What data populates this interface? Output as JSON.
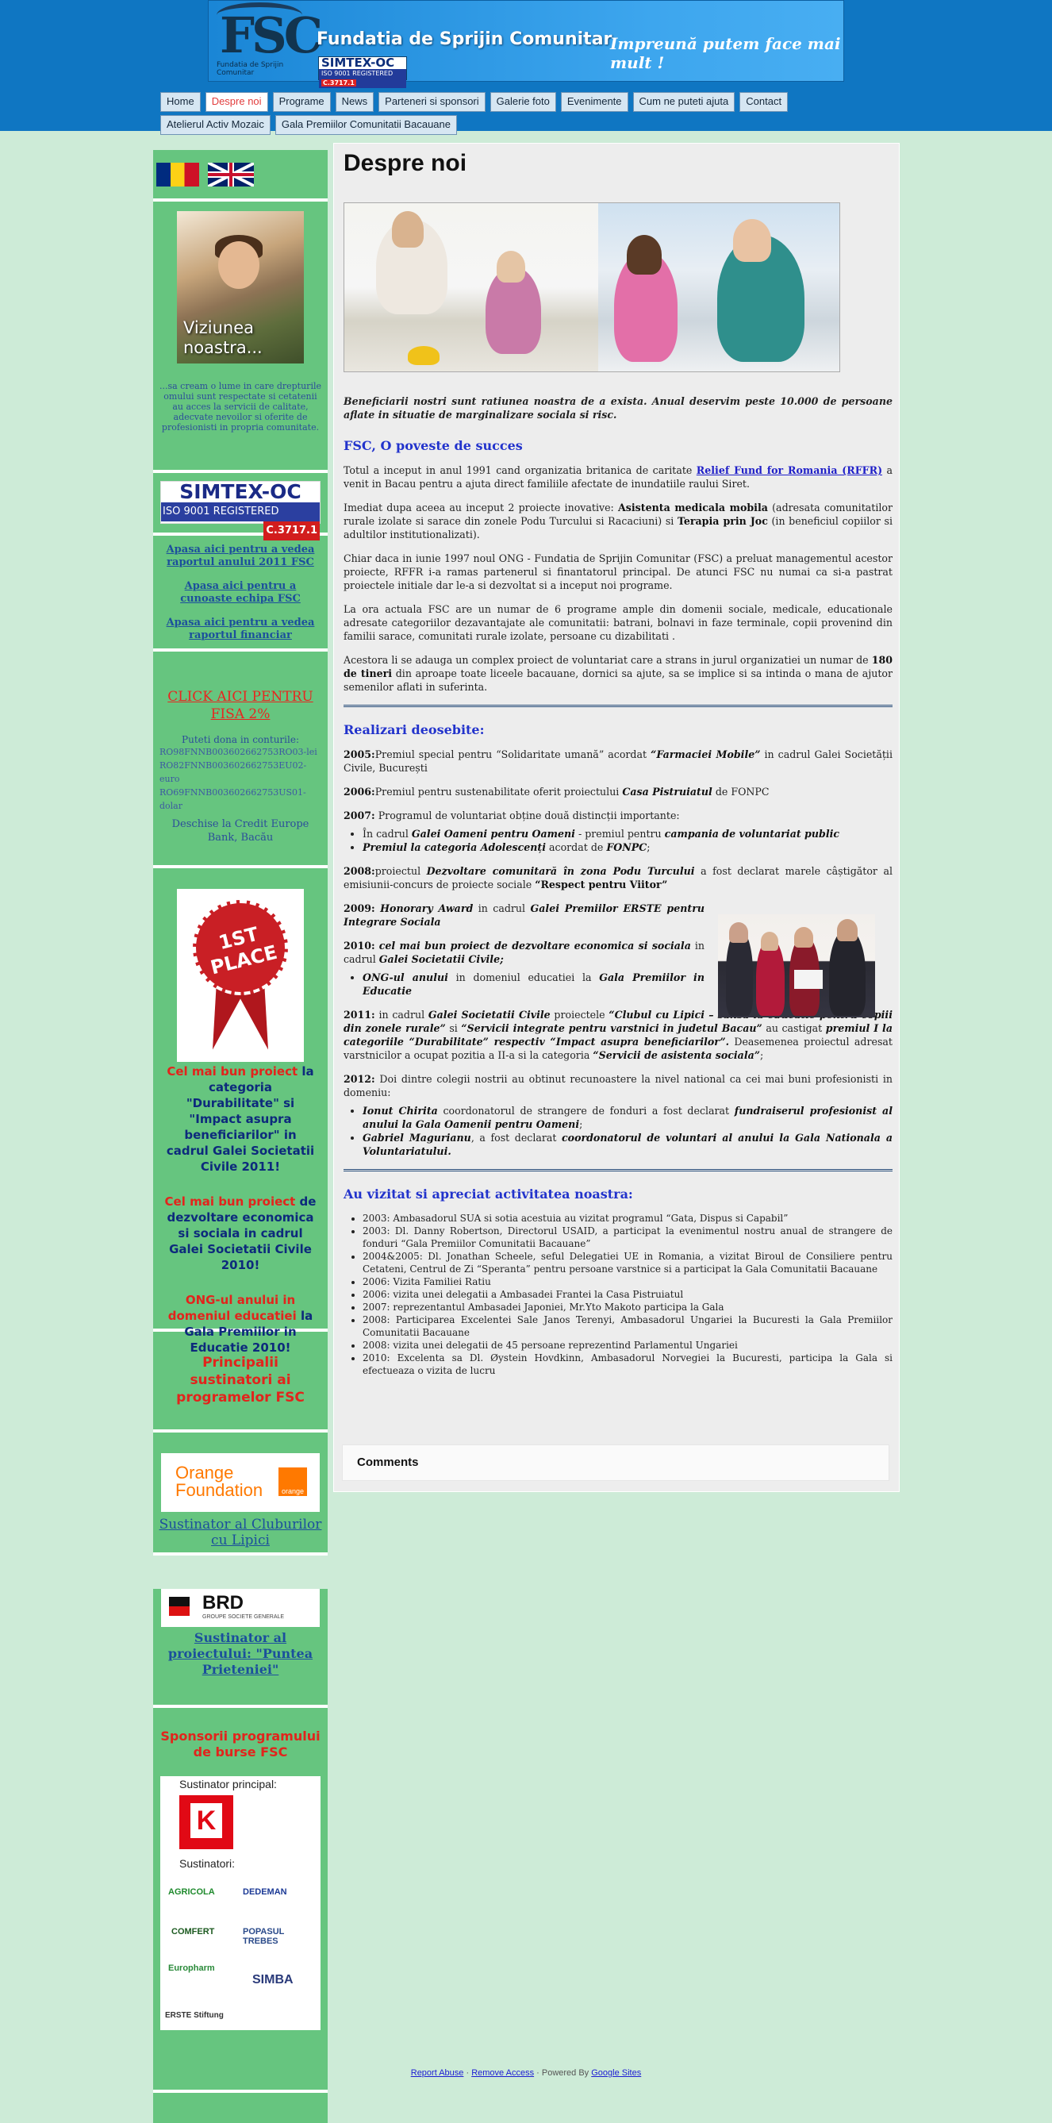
{
  "header": {
    "logo_text": "FSC",
    "logo_small": "Fundatia de Sprijin Comunitar",
    "title": "Fundatia de Sprijin Comunitar",
    "simtex_line1": "SIMTEX-OC",
    "simtex_line2": "ISO 9001 REGISTERED",
    "simtex_code": "C.3717.1",
    "slogan": "Impreună putem face mai mult !",
    "banner_color": "#1a86d6",
    "header_bg": "#0f76c2"
  },
  "nav": {
    "row1": [
      "Home",
      "Despre noi",
      "Programe",
      "News",
      "Parteneri si sponsori",
      "Galerie foto",
      "Evenimente",
      "Cum ne puteti ajuta",
      "Contact"
    ],
    "row2": [
      "Atelierul Activ Mozaic",
      "Gala Premiilor Comunitatii Bacauane"
    ],
    "active": "Despre noi",
    "active_color": "#e23c3c"
  },
  "sidebar": {
    "flags": [
      "flag-ro-icon",
      "flag-uk-icon"
    ],
    "vision_image_text": "Viziunea noastra...",
    "vision_text": "...sa cream o lume in care drepturile omului sunt respectate si cetatenii au acces la servicii de calitate, adecvate nevoilor si oferite de profesionisti in propria comunitate.",
    "simtex_line1": "SIMTEX-OC",
    "simtex_line2": "ISO 9001 REGISTERED",
    "simtex_code": "C.3717.1",
    "links": [
      "Apasa aici pentru a vedea raportul anului 2011 FSC",
      "Apasa aici pentru a cunoaste echipa FSC",
      "Apasa aici pentru a vedea raportul financiar "
    ],
    "fisa_link": "CLICK AICI PENTRU FISA 2%",
    "donation_title": "Puteti dona in conturile:",
    "accounts": [
      "RO98FNNB003602662753RO03-lei",
      "RO82FNNB003602662753EU02-euro",
      "RO69FNNB003602662753US01-dolar"
    ],
    "bank": "Deschise la Credit Europe Bank, Bacău",
    "ribbon_text": "1ST PLACE",
    "award1_red": "Cel mai bun proiect",
    "award1_rest": " la categoria \"Durabilitate\" si \"Impact asupra beneficiarilor\" in cadrul Galei Societatii Civile 2011!",
    "award2_red": "Cel mai bun proiect",
    "award2_rest": " de dezvoltare economica si sociala in cadrul Galei Societatii Civile 2010!",
    "award3_red": "ONG-ul anului in domeniul educatiei",
    "award3_rest": " la Gala Premiilor in Educatie 2010!",
    "supporters_title": "Principalii sustinatori ai programelor FSC",
    "orange_logo": "Orange Foundation",
    "orange_small": "orange",
    "orange_link": "Sustinator al Cluburilor cu Lipici",
    "brd_logo": "BRD",
    "brd_sub": "GROUPE SOCIETE GENERALE",
    "brd_link": "Sustinator al proiectului: \"Puntea Prieteniei\"",
    "bursa_title": "Sponsorii programului de burse FSC",
    "main_sponsor_label": "Sustinator principal:",
    "sponsors_label": "Sustinatori:",
    "sponsors": [
      "AGRICOLA",
      "DEDEMAN",
      "COMFERT",
      "POPASUL TREBES",
      "Europharm",
      "SIMBA",
      "ERSTE Stiftung"
    ],
    "sidebar_bg": "#66c57f"
  },
  "main": {
    "title": "Despre noi",
    "intro": "Beneficiarii nostri sunt ratiunea noastra de a exista. Anual deservim peste 10.000 de persoane aflate in situatie de marginalizare sociala si risc.",
    "story_title": "FSC, O poveste de succes",
    "p1_a": "Totul a inceput in anul 1991 cand organizatia britanica de caritate ",
    "p1_link": "Relief Fund for Romania (RFFR)",
    "p1_b": " a venit in Bacau pentru a ajuta direct familiile afectate de inundatiile raului Siret.",
    "p2_a": "Imediat dupa aceea au inceput 2 proiecte inovative: ",
    "p2_b1": "Asistenta medicala mobila",
    "p2_c": " (adresata comunitatilor rurale izolate si sarace din zonele Podu Turcului si Racaciuni) si ",
    "p2_b2": "Terapia prin Joc",
    "p2_d": " (in beneficiul copiilor si adultilor institutionalizati).",
    "p3": "Chiar daca in iunie 1997 noul ONG - Fundatia de Sprijin Comunitar (FSC) a preluat managementul acestor proiecte, RFFR i-a ramas partenerul si finantatorul principal. De atunci FSC nu numai ca si-a pastrat proiectele initiale dar le-a si dezvoltat si a inceput noi programe.",
    "p4": "La ora actuala FSC are un numar de 6 programe ample din domenii sociale, medicale, educationale adresate categoriilor dezavantajate ale comunitatii: batrani, bolnavi in faze terminale, copii  provenind din familii sarace, comunitati rurale izolate, persoane cu dizabilitati .",
    "p5_a": "Acestora li se adauga un complex proiect de voluntariat care a strans in jurul organizatiei un numar de ",
    "p5_b": "180 de tineri",
    "p5_c": " din aproape toate liceele bacauane, dornici sa ajute, sa se implice si sa intinda o mana de ajutor semenilor aflati in suferinta.",
    "ach_title": "Realizari deosebite:",
    "a2005_y": "2005:",
    "a2005_t": "Premiul special pentru “Solidaritate umană” acordat ",
    "a2005_b": "“Farmaciei Mobile”",
    "a2005_r": " in cadrul Galei Societății Civile, București",
    "a2006_y": "2006:",
    "a2006_t": "Premiul pentru sustenabilitate oferit proiectului ",
    "a2006_b": "Casa Pistruiatul",
    "a2006_r": " de FONPC",
    "a2007_y": "2007:",
    "a2007_t": " Programul de voluntariat obține două distincții importante:",
    "a2007_li1_a": "În cadrul ",
    "a2007_li1_b": "Galei Oameni pentru Oameni",
    "a2007_li1_c": " - premiul pentru ",
    "a2007_li1_d": "campania de voluntariat public",
    "a2007_li2_a": "Premiul la categoria Adolescenți",
    "a2007_li2_b": " acordat de ",
    "a2007_li2_c": "FONPC",
    "a2008_y": "2008:",
    "a2008_t": "proiectul ",
    "a2008_b": "Dezvoltare comunitară în zona Podu Turcului",
    "a2008_r": " a fost declarat marele câștigător al emisiunii-concurs de proiecte sociale ",
    "a2008_b2": "“Respect pentru Viitor”",
    "a2009_y": "2009:",
    "a2009_b": "Honorary Award",
    "a2009_t": " in cadrul  ",
    "a2009_b2": "Galei Premiilor ERSTE pentru Integrare Sociala",
    "a2010_y": "2010:",
    "a2010_b": "cel mai bun proiect de dezvoltare economica si sociala",
    "a2010_t": " in cadrul ",
    "a2010_b2": "Galei Societatii Civile;",
    "a2010_li_b": "ONG-ul anului",
    "a2010_li_t": " in domeniul educatiei la ",
    "a2010_li_b2": "Gala Premiilor in Educatie",
    "a2011_y": "2011:",
    "a2011_t": " in cadrul ",
    "a2011_b": "Galei Societatii Civile",
    "a2011_t2": " proiectele ",
    "a2011_b2": "“Clubul cu Lipici – sansa la educatie pentru copiii din zonele rurale”",
    "a2011_t3": " si ",
    "a2011_b3": "“Servicii integrate pentru varstnici in judetul Bacau”",
    "a2011_t4": " au castigat ",
    "a2011_b4": "premiul I la categoriile “Durabilitate” respectiv “Impact asupra beneficiarilor”.",
    "a2011_t5": " Deasemenea proiectul adresat varstnicilor a ocupat pozitia a II-a si la categoria ",
    "a2011_b5": "“Servicii de asistenta sociala”",
    "a2011_t6": ";",
    "a2012_y": "2012:",
    "a2012_t": " Doi dintre colegii nostrii au obtinut recunoastere la nivel national ca cei mai buni profesionisti in domeniu:",
    "a2012_li1_b": "Ionut Chirita",
    "a2012_li1_t": " coordonatorul de strangere de fonduri a fost declarat ",
    "a2012_li1_b2": "fundraiserul profesionist al anului la Gala Oamenii pentru Oameni",
    "a2012_li1_t2": ";",
    "a2012_li2_b": "Gabriel Magurianu",
    "a2012_li2_t": ", a fost declarat ",
    "a2012_li2_b2": "coordonatorul de voluntari al anului la Gala Nationala a Voluntariatului.",
    "visit_title": "Au vizitat si apreciat activitatea noastra:",
    "visits": [
      "2003: Ambasadorul SUA si sotia acestuia au vizitat programul “Gata, Dispus si Capabil”",
      "2003: Dl. Danny Robertson, Directorul USAID, a participat la evenimentul nostru anual de strangere de fonduri “Gala Premiilor Comunitatii Bacauane”",
      "2004&2005: Dl. Jonathan Scheele, seful Delegatiei UE in Romania, a vizitat Biroul de Consiliere pentru Cetateni, Centrul de Zi “Speranta” pentru persoane varstnice si a participat la Gala Comunitatii Bacauane",
      "2006: Vizita Familiei Ratiu",
      "2006: vizita unei delegatii a  Ambasadei Frantei la Casa Pistruiatul",
      "2007: reprezentantul Ambasadei Japoniei, Mr.Yto Makoto participa la Gala",
      "2008: Participarea Excelentei Sale Janos Terenyi, Ambasadorul Ungariei la Bucuresti la Gala Premiilor Comunitatii Bacauane",
      "2008: vizita unei delegatii de 45 persoane reprezentind  Parlamentul Ungariei",
      "2010: Excelenta sa Dl. Øystein Hovdkinn,  Ambasadorul Norvegiei la Bucuresti, participa la Gala si efectueaza o vizita de lucru"
    ],
    "comments": "Comments",
    "heading_color": "#2233cc",
    "main_bg": "#ededed"
  },
  "footer": {
    "report": "Report Abuse",
    "remove": "Remove Access",
    "powered": "Powered By",
    "sites": "Google Sites"
  },
  "page_bg": "#cdebd7"
}
